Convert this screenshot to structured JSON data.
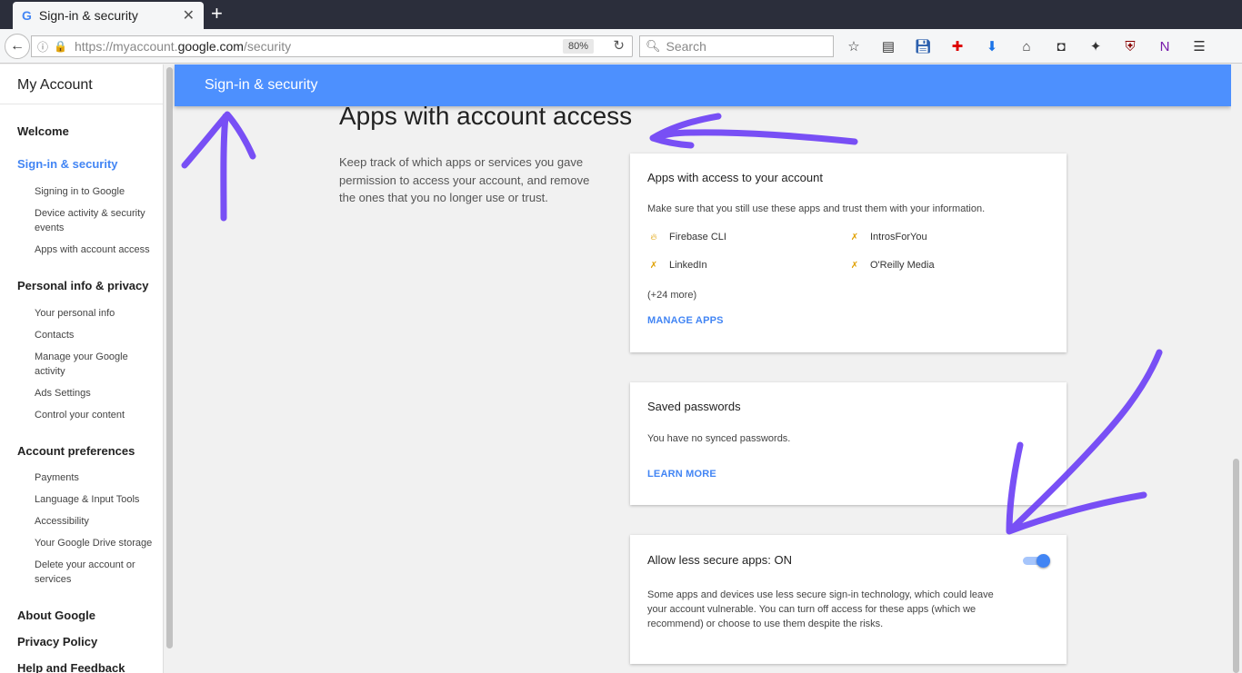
{
  "browser": {
    "tab_title": "Sign-in & security",
    "tab_favicon": "G",
    "url_prefix": "https://myaccount.",
    "url_domain": "google.com",
    "url_path": "/security",
    "zoom": "80%",
    "search_placeholder": "Search"
  },
  "sidebar": {
    "title": "My Account",
    "welcome": "Welcome",
    "signin": "Sign-in & security",
    "signin_items": [
      "Signing in to Google",
      "Device activity & security",
      "events",
      "Apps with account access"
    ],
    "personal": "Personal info & privacy",
    "personal_items": [
      "Your personal info",
      "Contacts",
      "Manage your Google",
      "activity",
      "Ads Settings",
      "Control your content"
    ],
    "prefs": "Account preferences",
    "prefs_items": [
      "Payments",
      "Language & Input Tools",
      "Accessibility",
      "Your Google Drive storage",
      "Delete your account or",
      "services"
    ],
    "about": "About Google",
    "privacy": "Privacy Policy",
    "help": "Help and Feedback"
  },
  "header": {
    "title": "Sign-in & security"
  },
  "main": {
    "heading": "Apps with account access",
    "intro": "Keep track of which apps or services you gave permission to access your account, and remove the ones that you no longer use or trust."
  },
  "apps_card": {
    "title": "Apps with access to your account",
    "desc": "Make sure that you still use these apps and trust them with your information.",
    "apps": [
      "Firebase CLI",
      "IntrosForYou",
      "LinkedIn",
      "O'Reilly Media"
    ],
    "more": "(+24 more)",
    "link": "MANAGE APPS"
  },
  "passwords_card": {
    "title": "Saved passwords",
    "desc": "You have no synced passwords.",
    "link": "LEARN MORE"
  },
  "lesssecure_card": {
    "title": "Allow less secure apps: ON",
    "desc_lines": [
      "Some apps and devices use less secure sign-in technology, which could leave",
      "your account vulnerable. You can turn off access for these apps (which we",
      "recommend) or choose to use them despite the risks."
    ],
    "toggle_on": true
  },
  "colors": {
    "accent": "#4285f4",
    "header": "#4d90fe",
    "annotation": "#6a3df5"
  }
}
